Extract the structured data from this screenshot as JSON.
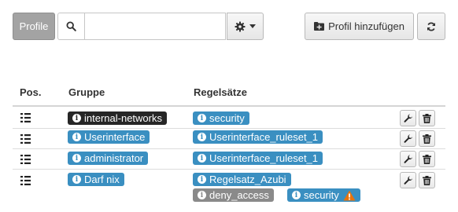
{
  "toolbar": {
    "profile_label": "Profile",
    "search_value": "",
    "search_placeholder": "",
    "add_profile_label": "Profil hinzufügen"
  },
  "table": {
    "headers": {
      "pos": "Pos.",
      "gruppe": "Gruppe",
      "regelsaetze": "Regelsätze"
    },
    "rows": [
      {
        "gruppe": "internal-networks",
        "gruppe_style": "dark",
        "regelsaetze": [
          {
            "label": "security",
            "style": "blue"
          }
        ]
      },
      {
        "gruppe": "Userinterface",
        "gruppe_style": "blue",
        "regelsaetze": [
          {
            "label": "Userinterface_ruleset_1",
            "style": "blue"
          }
        ]
      },
      {
        "gruppe": "administrator",
        "gruppe_style": "blue",
        "regelsaetze": [
          {
            "label": "Userinterface_ruleset_1",
            "style": "blue"
          }
        ]
      },
      {
        "gruppe": "Darf nix",
        "gruppe_style": "blue",
        "regelsaetze": [
          {
            "label": "Regelsatz_Azubi",
            "style": "blue"
          },
          {
            "label": "deny_access",
            "style": "grey"
          },
          {
            "label": "security",
            "style": "blue",
            "warning": true
          }
        ]
      }
    ]
  },
  "colors": {
    "tag_blue": "#3a8fc1",
    "tag_dark": "#262626",
    "tag_grey": "#8a8a8a",
    "warning": "#e8730c"
  },
  "icons": {
    "search": "search-icon",
    "settings": "gear-icon",
    "dropdown": "caret-down-icon",
    "add_profile": "folder-plus-icon",
    "refresh": "refresh-icon",
    "drag": "drag-handle-icon",
    "edit": "wrench-icon",
    "delete": "trash-icon",
    "info": "info-icon",
    "warning": "warning-icon"
  }
}
